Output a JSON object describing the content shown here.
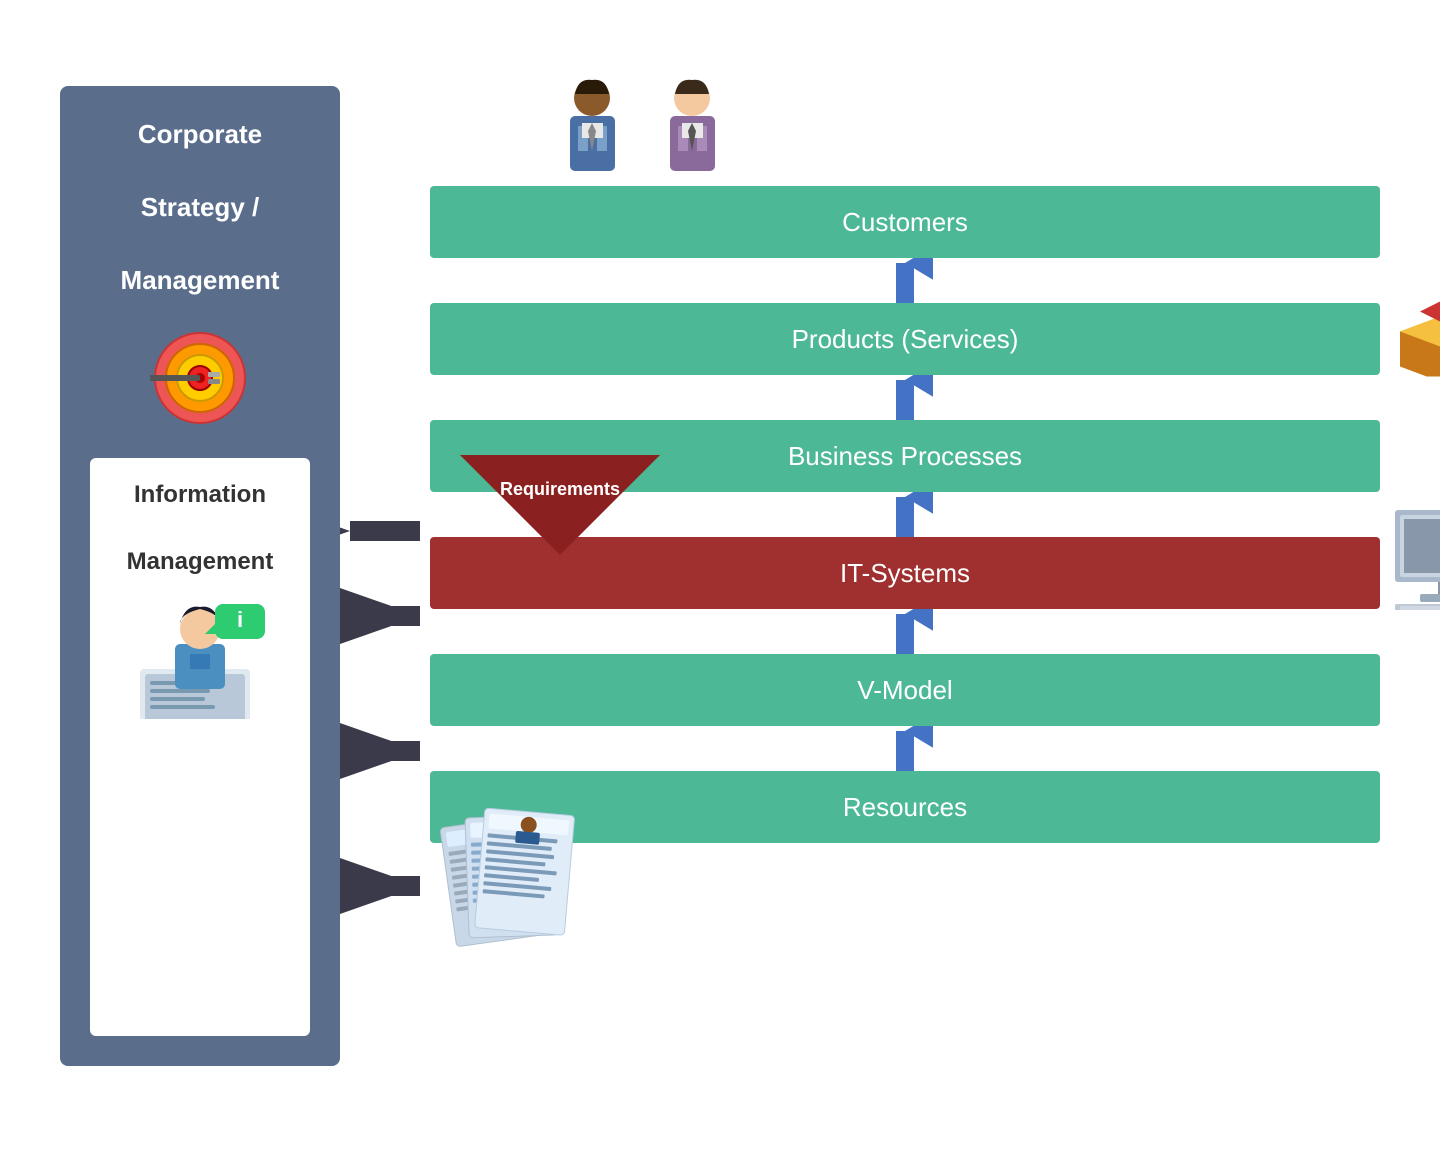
{
  "sidebar": {
    "top_text": "Corporate\n\nStrategy /\n\nManagement",
    "info_title": "Information\n\nManagement"
  },
  "rows": [
    {
      "id": "customers",
      "label": "Customers",
      "type": "green",
      "hasUpArrow": false,
      "hasPersonFigures": true
    },
    {
      "id": "products",
      "label": "Products (Services)",
      "type": "green",
      "hasUpArrow": true
    },
    {
      "id": "business-processes",
      "label": "Business Processes",
      "type": "green",
      "hasUpArrow": true,
      "hasRequirements": true
    },
    {
      "id": "it-systems",
      "label": "IT-Systems",
      "type": "red",
      "hasUpArrow": true,
      "hasComputerIcon": true
    },
    {
      "id": "v-model",
      "label": "V-Model",
      "type": "green",
      "hasUpArrow": true,
      "hasVLetter": true
    },
    {
      "id": "resources",
      "label": "Resources",
      "type": "green",
      "hasUpArrow": true,
      "hasDocsIcon": true
    }
  ],
  "requirements_label": "Requirements",
  "colors": {
    "green": "#4db896",
    "red": "#a03030",
    "sidebar_bg": "#5a6e8c",
    "blue_arrow": "#4472c4",
    "dark_arrow": "#3a3a4a"
  }
}
